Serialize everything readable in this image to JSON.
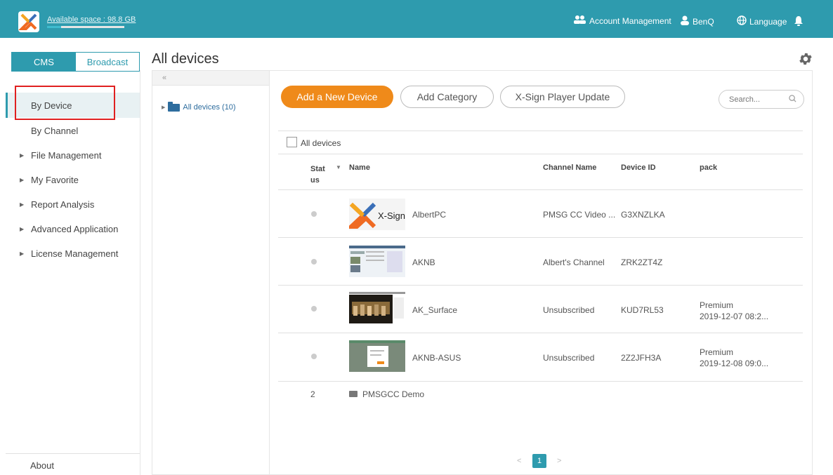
{
  "topbar": {
    "available_space": "Available space : 98.8 GB",
    "account_management": "Account Management",
    "user": "BenQ",
    "language": "Language",
    "accent": "#2e9bae"
  },
  "sidebar": {
    "tab_cms": "CMS",
    "tab_broadcast": "Broadcast",
    "items": [
      {
        "label": "By Device"
      },
      {
        "label": "By Channel"
      },
      {
        "label": "File Management"
      },
      {
        "label": "My Favorite"
      },
      {
        "label": "Report Analysis"
      },
      {
        "label": "Advanced Application"
      },
      {
        "label": "License Management"
      }
    ],
    "about": "About"
  },
  "page": {
    "title": "All devices"
  },
  "tree": {
    "collapse": "«",
    "root": "All devices (10)"
  },
  "toolbar": {
    "add_device": "Add a New Device",
    "add_category": "Add Category",
    "player_update": "X-Sign Player Update",
    "search_placeholder": "Search..."
  },
  "table": {
    "select_all_label": "All devices",
    "headers": {
      "status": "Stat us",
      "name": "Name",
      "channel": "Channel Name",
      "device_id": "Device ID",
      "pack": "pack"
    },
    "rows": [
      {
        "name": "AlbertPC",
        "channel": "PMSG CC Video ...",
        "device_id": "G3XNZLKA",
        "pack_type": "",
        "pack_date": "",
        "thumb": "xsign-logo"
      },
      {
        "name": "AKNB",
        "channel": "Albert's Channel",
        "device_id": "ZRK2ZT4Z",
        "pack_type": "",
        "pack_date": "",
        "thumb": "screenshot"
      },
      {
        "name": "AK_Surface",
        "channel": "Unsubscribed",
        "device_id": "KUD7RL53",
        "pack_type": "Premium",
        "pack_date": "2019-12-07 08:2...",
        "thumb": "photo"
      },
      {
        "name": "AKNB-ASUS",
        "channel": "Unsubscribed",
        "device_id": "2Z2JFH3A",
        "pack_type": "Premium",
        "pack_date": "2019-12-08 09:0...",
        "thumb": "screenshot"
      }
    ],
    "group": {
      "count": "2",
      "name": "PMSGCC Demo"
    }
  },
  "pagination": {
    "prev": "<",
    "current": "1",
    "next": ">"
  },
  "thumb_logo_text": "X-Sign"
}
